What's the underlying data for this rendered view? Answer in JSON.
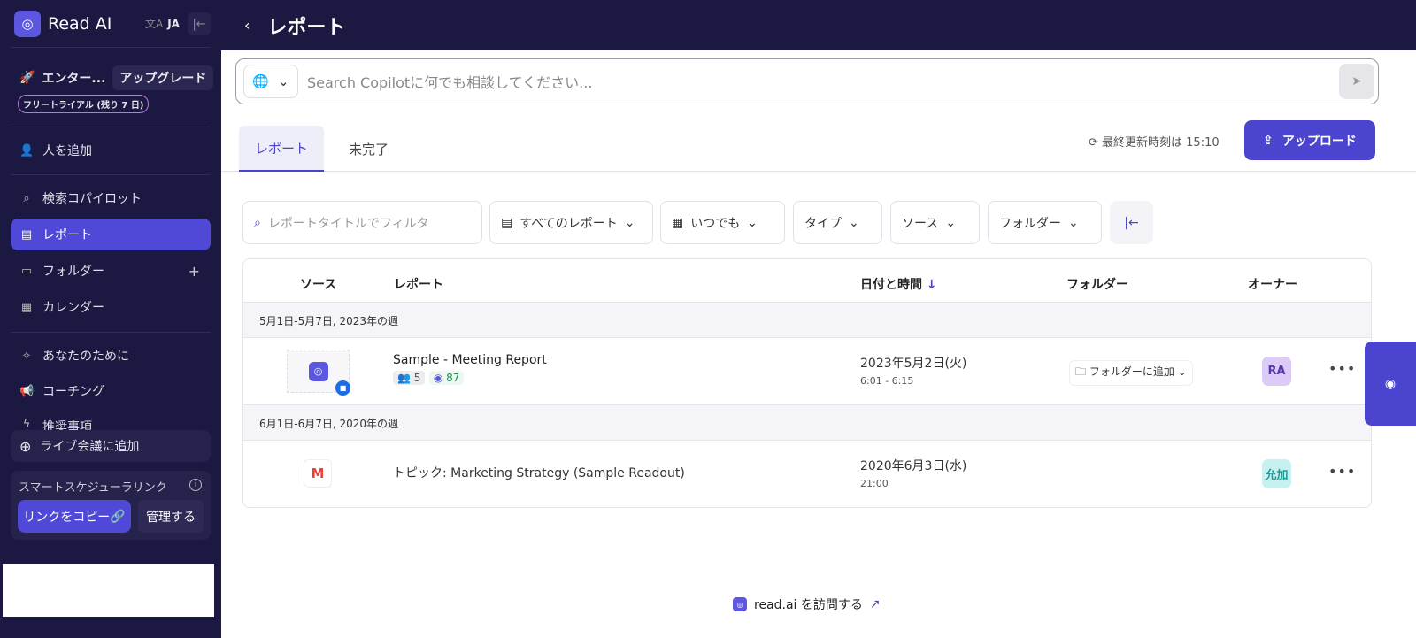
{
  "sidebar": {
    "brand": "Read AI",
    "lang": "JA",
    "plan": "エンター...",
    "upgrade": "アップグレード",
    "trial": "フリートライアル (残り 7 日)",
    "items": [
      {
        "label": "人を追加",
        "icon": "add-user-icon"
      },
      {
        "label": "検索コパイロット",
        "icon": "search-icon"
      },
      {
        "label": "レポート",
        "icon": "report-icon"
      },
      {
        "label": "フォルダー",
        "icon": "folder-icon"
      },
      {
        "label": "カレンダー",
        "icon": "calendar-icon"
      },
      {
        "label": "あなたのために",
        "icon": "sparkle-icon"
      },
      {
        "label": "コーチング",
        "icon": "megaphone-icon"
      },
      {
        "label": "推奨事項",
        "icon": "recommend-icon"
      }
    ],
    "live": "ライブ会議に追加",
    "smart_title": "スマートスケジューラリンク",
    "copy": "リンクをコピー",
    "manage": "管理する"
  },
  "header": {
    "title": "レポート"
  },
  "search": {
    "placeholder": "Search Copilotに何でも相談してください..."
  },
  "tabs": [
    "レポート",
    "未完了"
  ],
  "updated": "最終更新時刻は 15:10",
  "upload": "アップロード",
  "filters": {
    "placeholder": "レポートタイトルでフィルタ",
    "all": "すべてのレポート",
    "when": "いつでも",
    "type": "タイプ",
    "source": "ソース",
    "folder": "フォルダー"
  },
  "table": {
    "headers": [
      "ソース",
      "レポート",
      "日付と時間",
      "フォルダー",
      "オーナー"
    ],
    "groups": [
      {
        "label": "5月1日-5月7日, 2023年の週",
        "rows": [
          {
            "title": "Sample - Meeting Report",
            "participants": "5",
            "score": "87",
            "date": "2023年5月2日(火)",
            "time": "6:01 - 6:15",
            "folder": "フォルダーに追加",
            "owner": "RA"
          }
        ]
      },
      {
        "label": "6月1日-6月7日, 2020年の週",
        "rows": [
          {
            "title": "トピック: Marketing Strategy (Sample Readout)",
            "date": "2020年6月3日(水)",
            "time": "21:00",
            "owner": "允加"
          }
        ]
      }
    ]
  },
  "footer": {
    "visit": "read.ai を訪問する"
  },
  "colors": {
    "sidebar": "#1b1942",
    "accent": "#4b44cf"
  }
}
